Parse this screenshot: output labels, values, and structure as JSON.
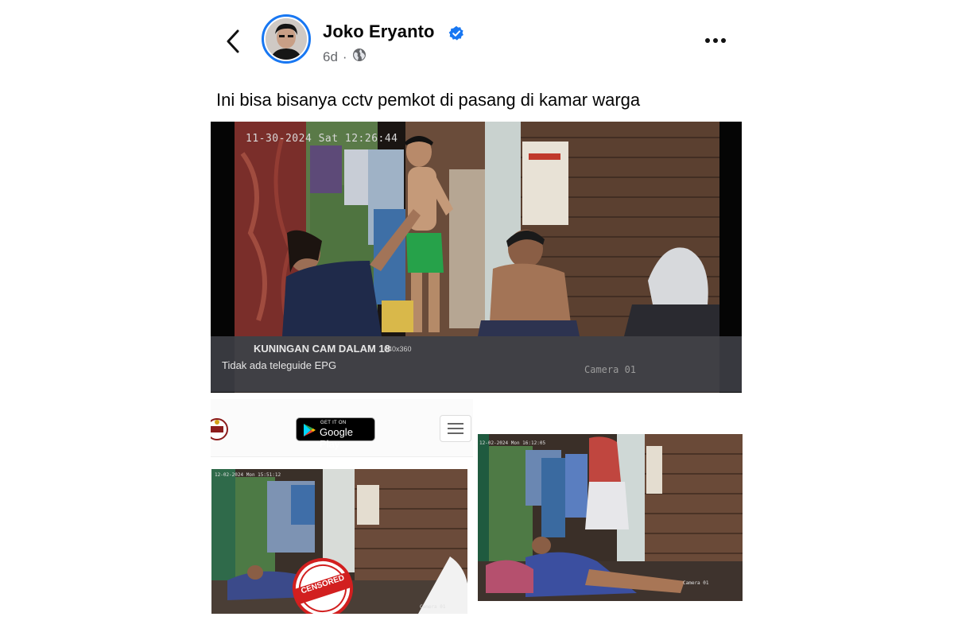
{
  "post": {
    "author": "Joko Eryanto",
    "time": "6d",
    "separator": "·",
    "caption": "Ini bisa bisanya cctv pemkot di pasang di kamar warga"
  },
  "main_image": {
    "timestamp": "11-30-2024 Sat 12:26:44",
    "channel": "KUNINGAN CAM DALAM 18",
    "resolution": "640x360",
    "epg": "Tidak ada teleguide EPG",
    "camera": "Camera 01"
  },
  "bottom_left": {
    "store_small": "GET IT ON",
    "store_big": "Google Play",
    "timestamp": "12-02-2024 Mon 15:51:12",
    "stamp_text": "CENSORED",
    "camera": "Camera 01"
  },
  "bottom_right": {
    "timestamp": "12-02-2024 Mon 16:12:05",
    "camera": "Camera 01"
  },
  "icons": {
    "back": "chevron-left-icon",
    "verified": "verified-badge-icon",
    "audience": "globe-icon",
    "more": "more-horizontal-icon",
    "menu": "hamburger-menu-icon",
    "play": "google-play-icon"
  },
  "colors": {
    "verified_blue": "#1877f2",
    "meta_gray": "#65676b",
    "stamp_red": "#d21f1f"
  }
}
